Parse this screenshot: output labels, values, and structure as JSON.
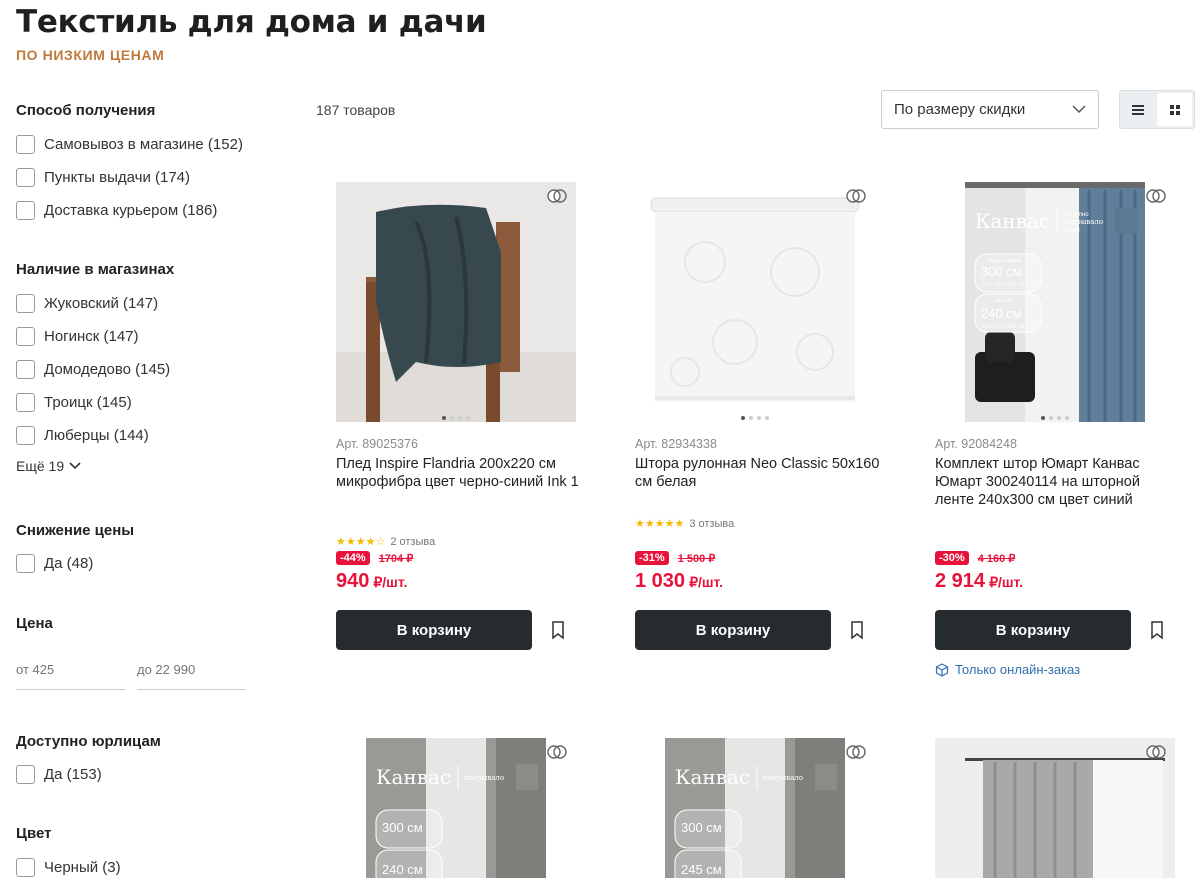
{
  "header": {
    "title": "Текстиль для дома и дачи",
    "subtitle": "ПО НИЗКИМ ЦЕНАМ"
  },
  "filters": {
    "delivery": {
      "title": "Способ получения",
      "options": [
        "Самовывоз в магазине (152)",
        "Пункты выдачи (174)",
        "Доставка курьером (186)"
      ]
    },
    "stores": {
      "title": "Наличие в магазинах",
      "options": [
        "Жуковский (147)",
        "Ногинск (147)",
        "Домодедово (145)",
        "Троицк (145)",
        "Люберцы (144)"
      ],
      "more": "Ещё 19"
    },
    "discount": {
      "title": "Снижение цены",
      "options": [
        "Да (48)"
      ]
    },
    "price": {
      "title": "Цена",
      "from_placeholder": "от 425",
      "to_placeholder": "до 22 990"
    },
    "legal": {
      "title": "Доступно юрлицам",
      "options": [
        "Да (153)"
      ]
    },
    "color": {
      "title": "Цвет",
      "options": [
        "Черный (3)"
      ]
    }
  },
  "toolbar": {
    "count": "187 товаров",
    "sort": "По размеру скидки"
  },
  "products": [
    {
      "art": "Арт. 89025376",
      "name": "Плед Inspire Flandria 200x220 см микрофибра цвет черно-синий Ink 1",
      "reviews": "2 отзыва",
      "rating": 4.5,
      "discount": "-44%",
      "old_price": "1704 ₽",
      "price": "940",
      "unit": "₽/шт.",
      "cart": "В корзину"
    },
    {
      "art": "Арт. 82934338",
      "name": "Штора рулонная Neo Classic 50x160 см белая",
      "reviews": "3 отзыва",
      "rating": 5,
      "discount": "-31%",
      "old_price": "1 500 ₽",
      "price": "1 030",
      "unit": "₽/шт.",
      "cart": "В корзину"
    },
    {
      "art": "Арт. 92084248",
      "name": "Комплект штор Юмарт Канвас Юмарт 300240114 на шторной ленте 240x300 см цвет синий",
      "discount": "-30%",
      "old_price": "4 160 ₽",
      "price": "2 914",
      "unit": "₽/шт.",
      "cart": "В корзину",
      "online": "Только онлайн-заказ"
    }
  ],
  "promo": {
    "brand": "Канвас",
    "tag1": "доступно",
    "tag2": "покрывало",
    "tag3": "в цвет",
    "w_label": "общая ширина",
    "w1": "300 см",
    "w1_sub": "есть 200 и 400 см",
    "h_label": "высота",
    "h1": "240 см",
    "h1_sub": "есть 270 и 280 см",
    "h2": "245 см"
  },
  "colors": {
    "accent_red": "#e8123a",
    "button_dark": "#262b2f",
    "subtitle_orange": "#c1793a",
    "link_blue": "#2f6fb0"
  }
}
